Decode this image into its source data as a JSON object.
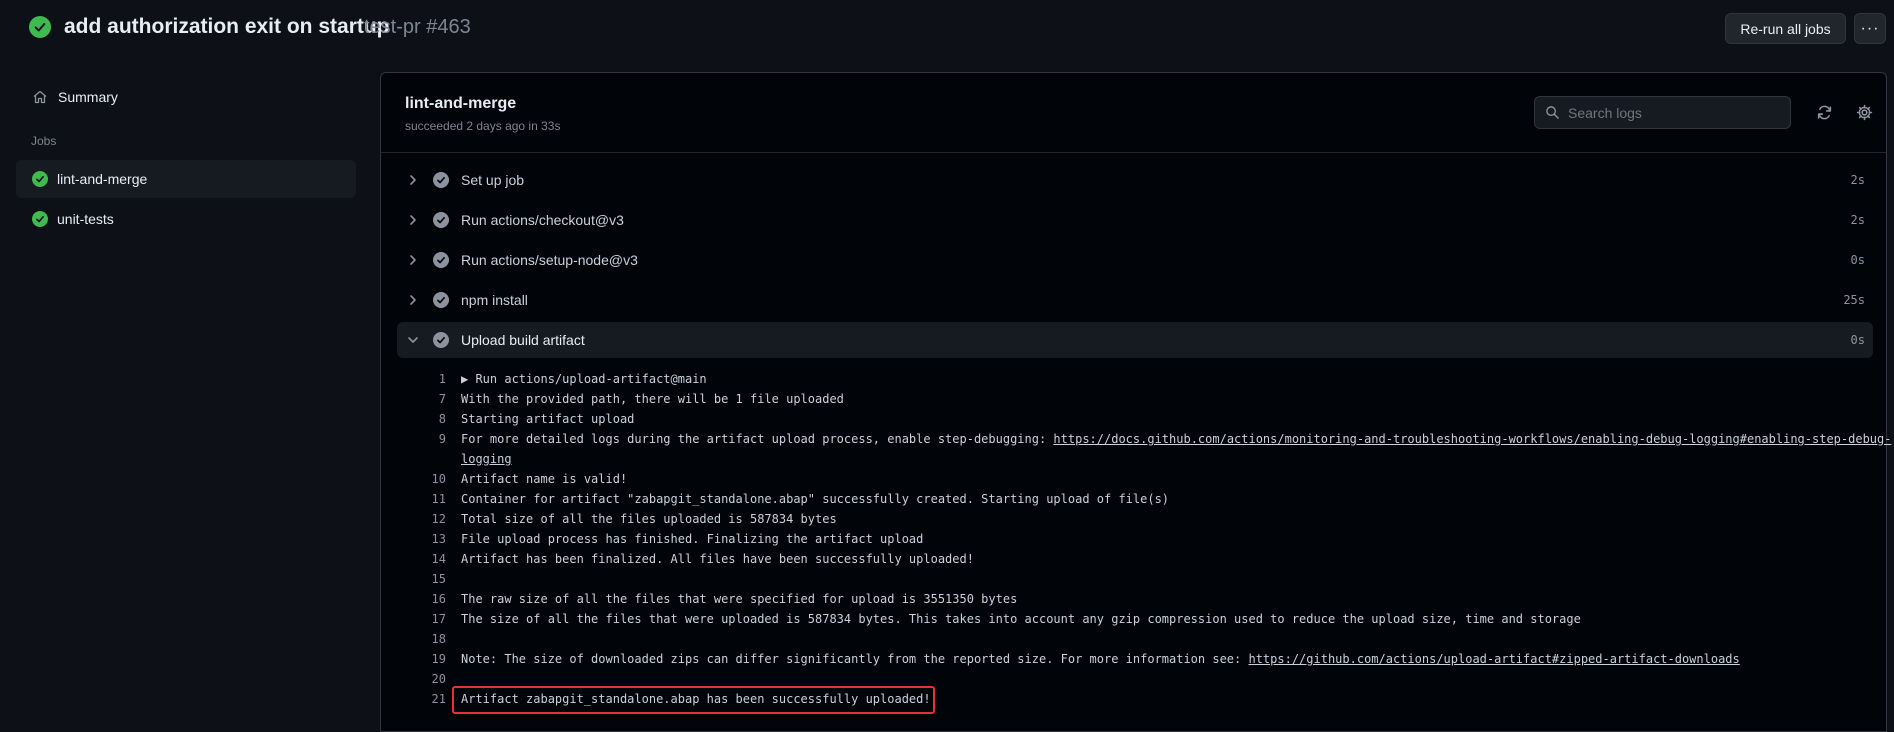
{
  "header": {
    "title": "add authorization exit on startup",
    "subtitle": "test-pr #463",
    "rerun_label": "Re-run all jobs",
    "more_label": "···"
  },
  "sidebar": {
    "summary_label": "Summary",
    "jobs_heading": "Jobs",
    "jobs": [
      {
        "label": "lint-and-merge",
        "status": "success",
        "active": true
      },
      {
        "label": "unit-tests",
        "status": "success",
        "active": false
      }
    ]
  },
  "main": {
    "job_title": "lint-and-merge",
    "job_status": "succeeded 2 days ago in 33s",
    "search_placeholder": "Search logs",
    "steps": [
      {
        "name": "Set up job",
        "duration": "2s",
        "expanded": false
      },
      {
        "name": "Run actions/checkout@v3",
        "duration": "2s",
        "expanded": false
      },
      {
        "name": "Run actions/setup-node@v3",
        "duration": "0s",
        "expanded": false
      },
      {
        "name": "npm install",
        "duration": "25s",
        "expanded": false
      },
      {
        "name": "Upload build artifact",
        "duration": "0s",
        "expanded": true
      }
    ],
    "log": [
      {
        "num": "1",
        "text": "▶ Run actions/upload-artifact@main"
      },
      {
        "num": "7",
        "text": "With the provided path, there will be 1 file uploaded"
      },
      {
        "num": "8",
        "text": "Starting artifact upload"
      },
      {
        "num": "9",
        "text": "For more detailed logs during the artifact upload process, enable step-debugging: ",
        "link": "https://docs.github.com/actions/monitoring-and-troubleshooting-workflows/enabling-debug-logging#enabling-step-debug-",
        "link_cont": "logging"
      },
      {
        "num": "10",
        "text": "Artifact name is valid!"
      },
      {
        "num": "11",
        "text": "Container for artifact \"zabapgit_standalone.abap\" successfully created. Starting upload of file(s)"
      },
      {
        "num": "12",
        "text": "Total size of all the files uploaded is 587834 bytes"
      },
      {
        "num": "13",
        "text": "File upload process has finished. Finalizing the artifact upload"
      },
      {
        "num": "14",
        "text": "Artifact has been finalized. All files have been successfully uploaded!"
      },
      {
        "num": "15",
        "text": ""
      },
      {
        "num": "16",
        "text": "The raw size of all the files that were specified for upload is 3551350 bytes"
      },
      {
        "num": "17",
        "text": "The size of all the files that were uploaded is 587834 bytes. This takes into account any gzip compression used to reduce the upload size, time and storage"
      },
      {
        "num": "18",
        "text": ""
      },
      {
        "num": "19",
        "text": "Note: The size of downloaded zips can differ significantly from the reported size. For more information see: ",
        "link": "https://github.com/actions/upload-artifact#zipped-artifact-downloads"
      },
      {
        "num": "20",
        "text": ""
      },
      {
        "num": "21",
        "text": "Artifact zabapgit_standalone.abap has been successfully uploaded!"
      }
    ]
  },
  "colors": {
    "success": "#3fb950",
    "step_check": "#8b949e",
    "highlight": "#e5323a"
  }
}
